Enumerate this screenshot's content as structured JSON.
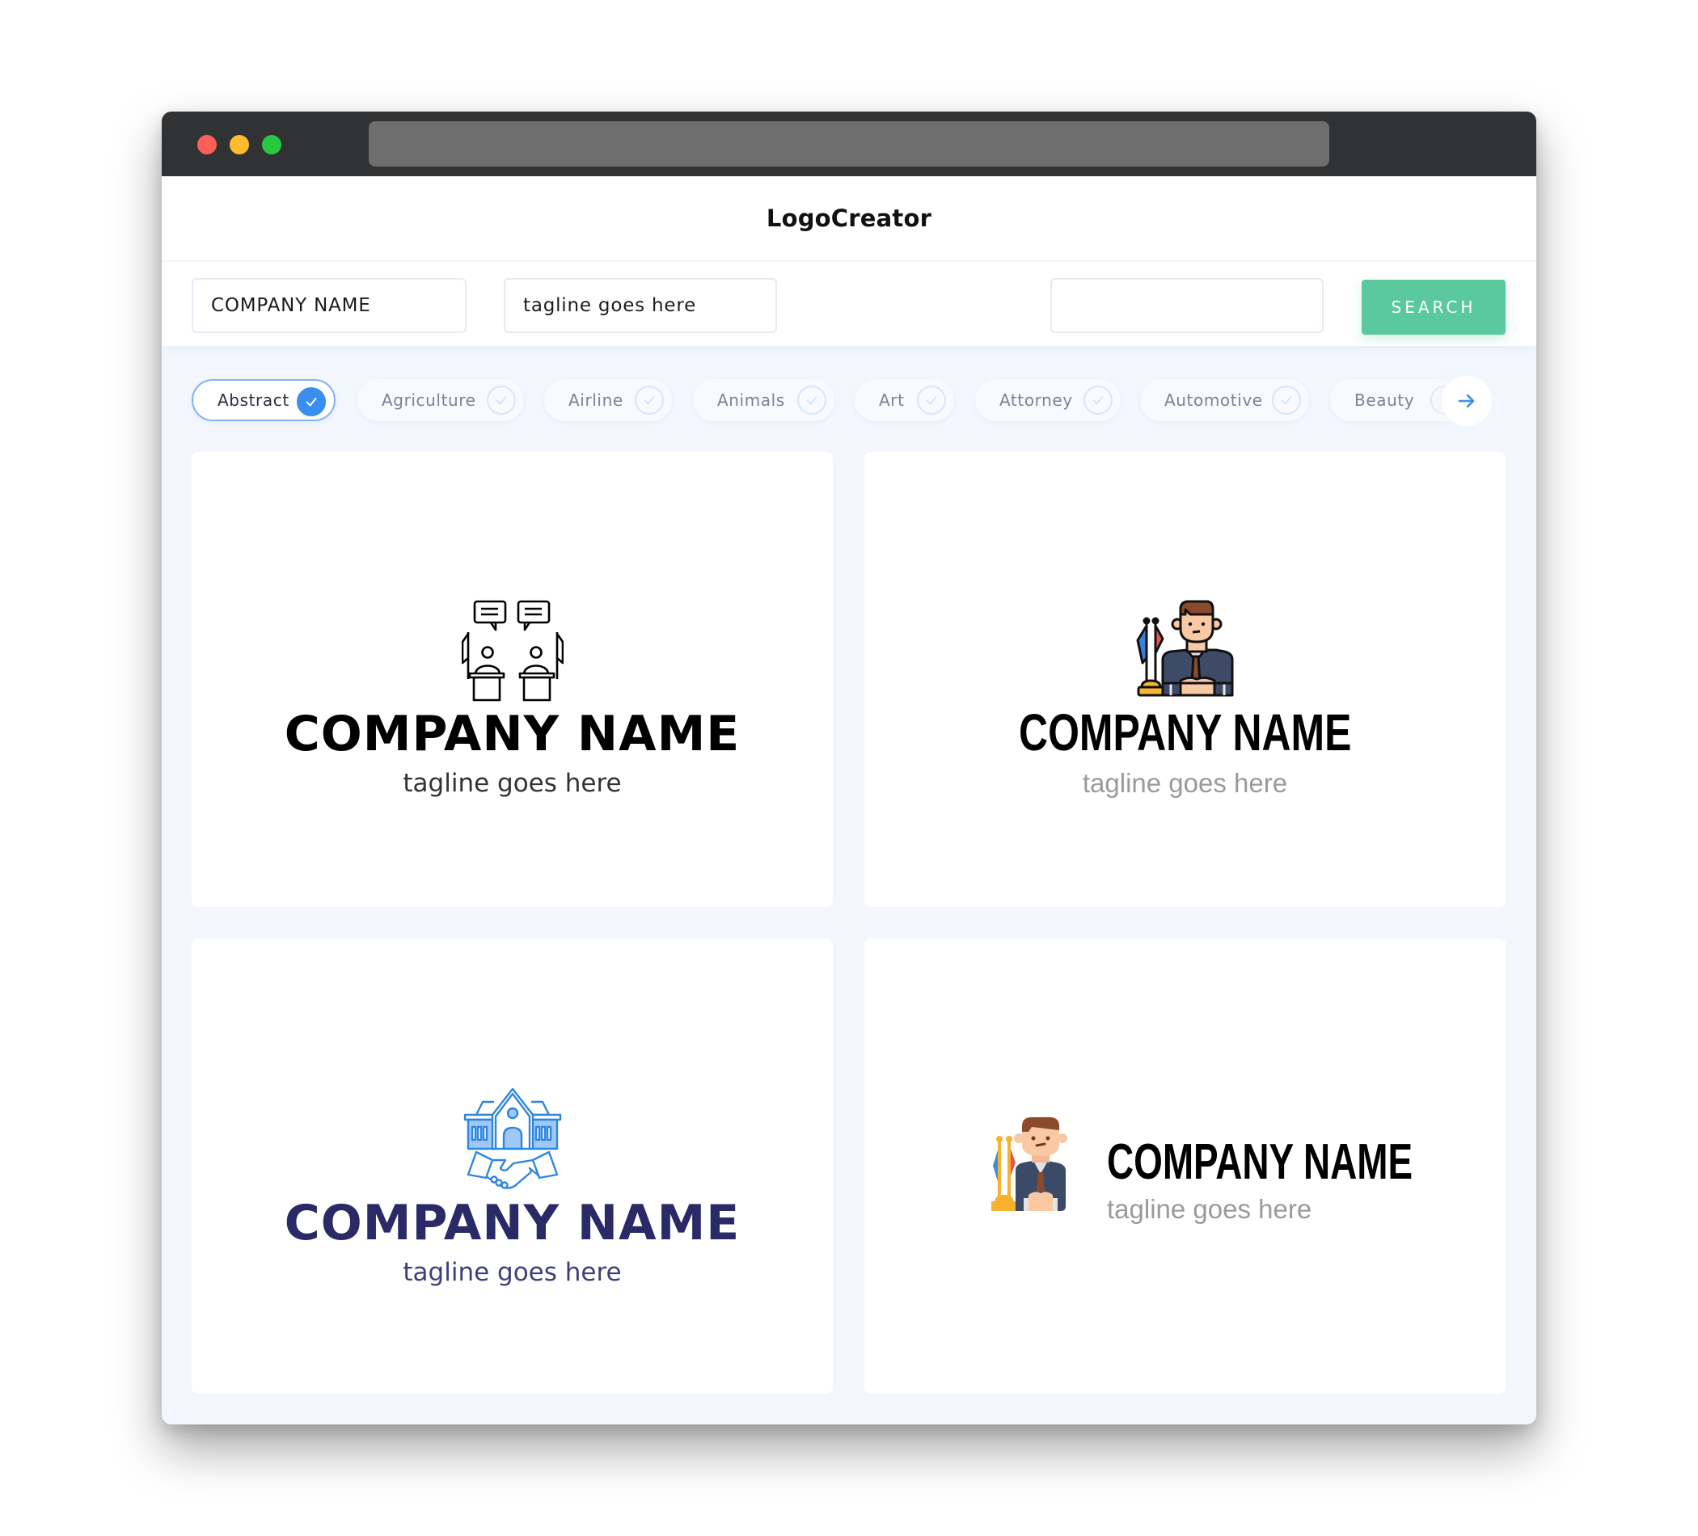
{
  "window": {
    "controls": [
      "close",
      "minimize",
      "maximize"
    ],
    "url": ""
  },
  "header": {
    "brand": "LogoCreator"
  },
  "search": {
    "company_name_value": "COMPANY NAME",
    "tagline_value": "tagline goes here",
    "keyword_value": "",
    "button_label": "SEARCH"
  },
  "categories": {
    "items": [
      {
        "label": "Abstract",
        "selected": true
      },
      {
        "label": "Agriculture",
        "selected": false
      },
      {
        "label": "Airline",
        "selected": false
      },
      {
        "label": "Animals",
        "selected": false
      },
      {
        "label": "Art",
        "selected": false
      },
      {
        "label": "Attorney",
        "selected": false
      },
      {
        "label": "Automotive",
        "selected": false
      },
      {
        "label": "Beauty",
        "selected": false
      }
    ],
    "next_icon": "arrow-right-icon"
  },
  "logos": [
    {
      "company": "COMPANY NAME",
      "tagline": "tagline goes here",
      "icon": "debate-podiums-icon",
      "layout": "stacked",
      "name_color": "#000000",
      "tagline_color": "#333333"
    },
    {
      "company": "COMPANY NAME",
      "tagline": "tagline goes here",
      "icon": "politician-outline-icon",
      "layout": "stacked",
      "name_color": "#000000",
      "tagline_color": "#9a9a9a"
    },
    {
      "company": "COMPANY NAME",
      "tagline": "tagline goes here",
      "icon": "building-handshake-icon",
      "layout": "stacked",
      "name_color": "#292a66",
      "tagline_color": "#3e3f78"
    },
    {
      "company": "COMPANY NAME",
      "tagline": "tagline goes here",
      "icon": "politician-flat-icon",
      "layout": "inline",
      "name_color": "#000000",
      "tagline_color": "#9a9a9a"
    }
  ],
  "colors": {
    "accent": "#3a8ef0",
    "search_button": "#5bc99f",
    "titlebar": "#313234",
    "page_bg": "#f3f6fd"
  }
}
